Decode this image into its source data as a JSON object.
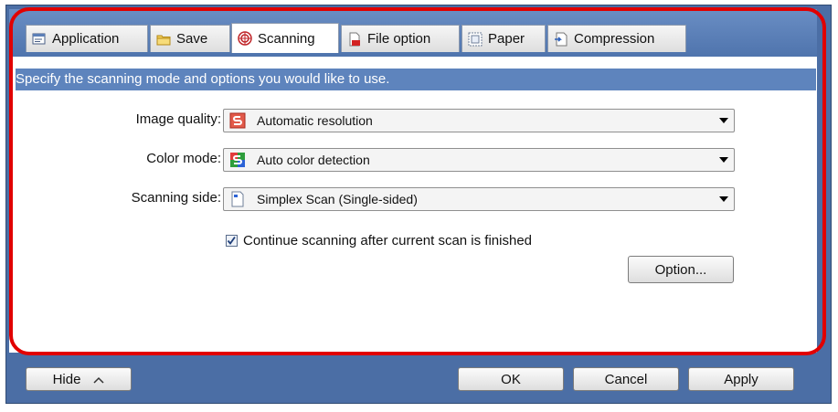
{
  "tabs": [
    {
      "label": "Application",
      "icon": "application-icon",
      "active": false
    },
    {
      "label": "Save",
      "icon": "folder-icon",
      "active": false
    },
    {
      "label": "Scanning",
      "icon": "scanning-icon",
      "active": true
    },
    {
      "label": "File option",
      "icon": "file-option-icon",
      "active": false
    },
    {
      "label": "Paper",
      "icon": "paper-icon",
      "active": false
    },
    {
      "label": "Compression",
      "icon": "compression-icon",
      "active": false
    }
  ],
  "banner": "Specify the scanning mode and options you would like to use.",
  "fields": {
    "image_quality": {
      "label": "Image quality:",
      "value": "Automatic resolution",
      "icon": "auto-resolution-icon"
    },
    "color_mode": {
      "label": "Color mode:",
      "value": "Auto color detection",
      "icon": "auto-color-icon"
    },
    "scanning_side": {
      "label": "Scanning side:",
      "value": "Simplex Scan (Single-sided)",
      "icon": "simplex-icon"
    }
  },
  "continue_scanning": {
    "label": "Continue scanning after current scan is finished",
    "checked": true
  },
  "option_button": "Option...",
  "footer": {
    "hide": "Hide",
    "ok": "OK",
    "cancel": "Cancel",
    "apply": "Apply"
  },
  "colors": {
    "frame": "#4b6ea5",
    "banner": "#5e84bd",
    "highlight": "#e10000"
  }
}
